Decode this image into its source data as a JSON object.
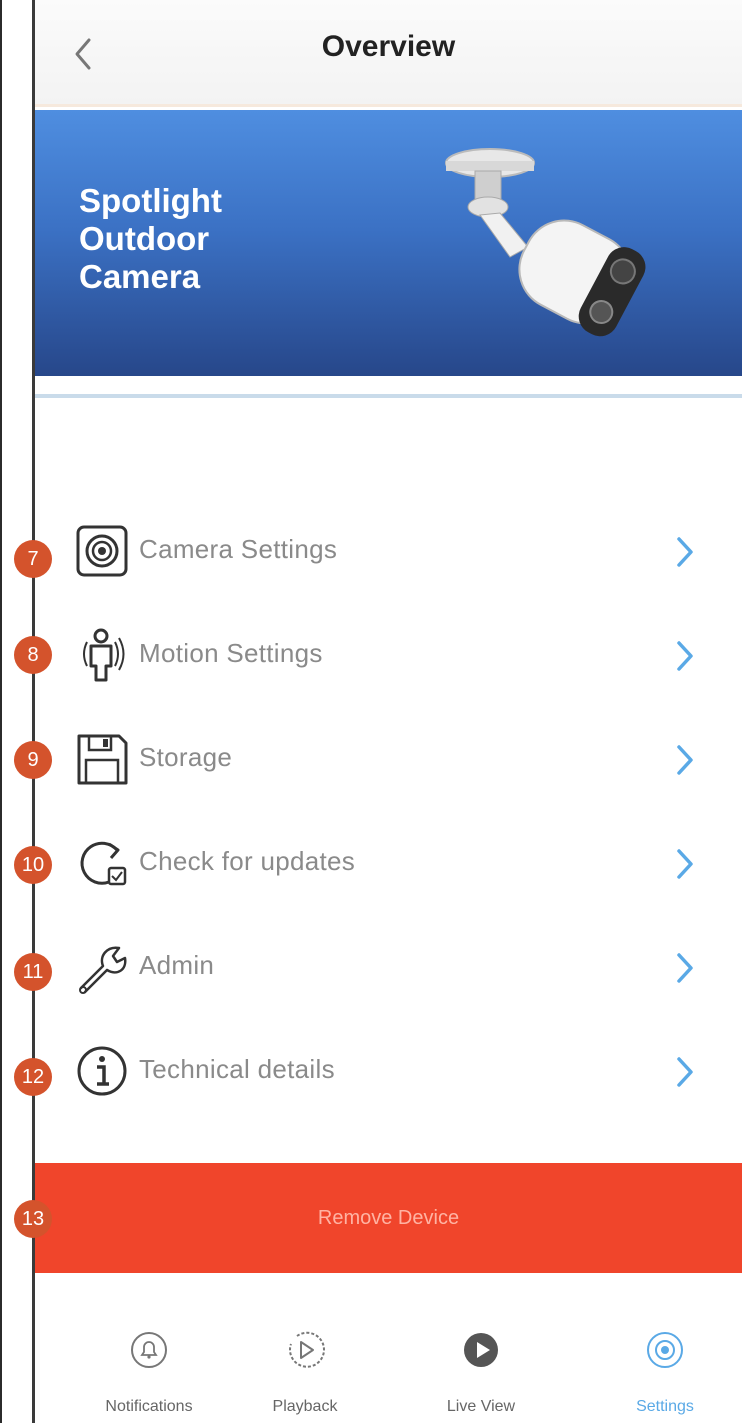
{
  "header": {
    "title": "Overview"
  },
  "banner": {
    "title_lines": [
      "Spotlight",
      "Outdoor",
      "Camera"
    ]
  },
  "menu": {
    "items": [
      {
        "label": "Camera Settings",
        "icon": "camera-settings-icon",
        "badge": "7"
      },
      {
        "label": "Motion Settings",
        "icon": "motion-person-icon",
        "badge": "8"
      },
      {
        "label": "Storage",
        "icon": "floppy-disk-icon",
        "badge": "9"
      },
      {
        "label": "Check for updates",
        "icon": "update-refresh-icon",
        "badge": "10"
      },
      {
        "label": "Admin",
        "icon": "wrench-icon",
        "badge": "11"
      },
      {
        "label": "Technical details",
        "icon": "info-icon",
        "badge": "12"
      }
    ]
  },
  "remove": {
    "label": "Remove Device",
    "badge": "13"
  },
  "tabbar": {
    "tabs": [
      {
        "label": "Notifications",
        "icon": "bell-icon"
      },
      {
        "label": "Playback",
        "icon": "playback-icon"
      },
      {
        "label": "Live View",
        "icon": "live-view-play-icon"
      },
      {
        "label": "Settings",
        "icon": "settings-icon",
        "active": true
      }
    ]
  },
  "colors": {
    "accent_blue": "#5aa9e6",
    "remove_red": "#f0452b",
    "badge_orange": "#d4532c",
    "banner_top": "#4f8ee0",
    "banner_bottom": "#27478a"
  }
}
